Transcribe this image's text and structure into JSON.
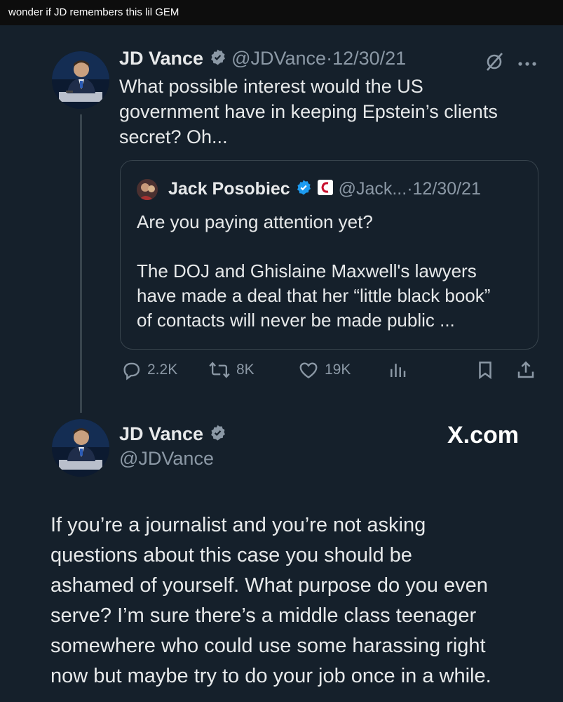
{
  "caption": "wonder if JD remembers this lil GEM",
  "tweet1": {
    "name": "JD Vance",
    "handle": "@JDVance",
    "separator": "·",
    "date": "12/30/21",
    "text_lines": [
      "What possible interest would the US",
      "government have in keeping Epstein’s clients",
      "secret? Oh..."
    ],
    "avatar_icon": "profile-photo",
    "verified_color": "#1d9bf0"
  },
  "quote": {
    "name": "Jack Posobiec",
    "handle": "@Jack...",
    "separator": "·",
    "date": "12/30/21",
    "paragraph1": "Are you paying attention yet?",
    "paragraph2_lines": [
      "The DOJ and Ghislaine Maxwell's lawyers",
      "have made a deal that her “little black book”",
      "of contacts will never be made public ..."
    ]
  },
  "actions": {
    "replies": "2.2K",
    "reposts": "8K",
    "likes": "19K",
    "icons": [
      "reply-icon",
      "repost-icon",
      "like-icon",
      "views-icon",
      "bookmark-icon",
      "share-icon"
    ]
  },
  "tweet2": {
    "name": "JD Vance",
    "handle": "@JDVance",
    "brand": "X.com",
    "text_lines": [
      "If you’re a journalist and you’re not asking",
      "questions about this case you should be",
      "ashamed of yourself. What purpose do you even",
      "serve? I’m sure there’s a middle class teenager",
      "somewhere who could use some harassing right",
      "now but maybe try to do your job once in a while."
    ]
  },
  "colors": {
    "background": "#15202b",
    "text": "#e7e9ea",
    "muted": "#8b98a5",
    "border": "#38444d",
    "verified": "#1d9bf0"
  }
}
